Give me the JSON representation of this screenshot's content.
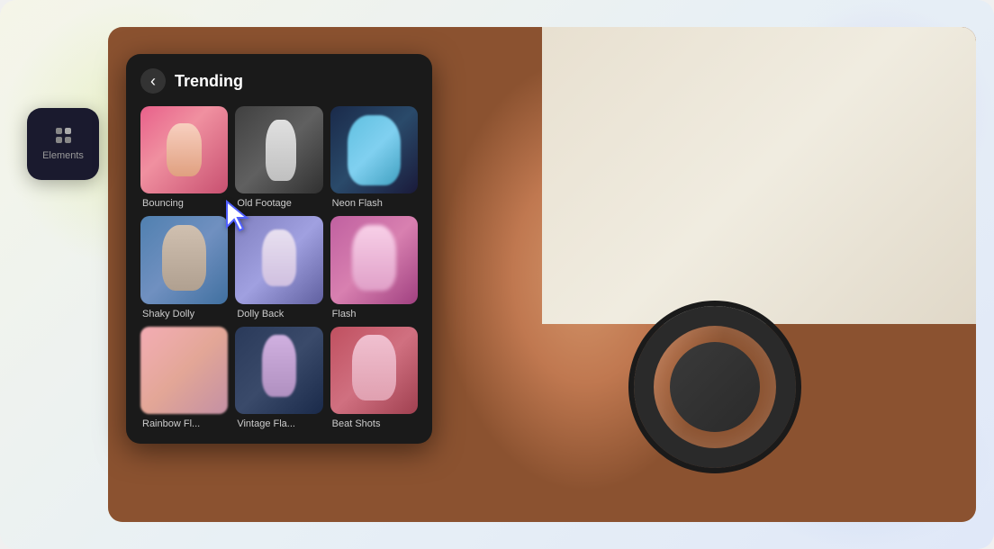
{
  "panel": {
    "title": "Trending",
    "back_button_label": "‹"
  },
  "elements_sidebar": {
    "label": "Elements"
  },
  "effects": [
    {
      "id": "bouncing",
      "label": "Bouncing",
      "thumb_class": "thumb-bouncing"
    },
    {
      "id": "old-footage",
      "label": "Old Footage",
      "thumb_class": "thumb-old-footage"
    },
    {
      "id": "neon-flash",
      "label": "Neon Flash",
      "thumb_class": "thumb-neon-flash"
    },
    {
      "id": "shaky-dolly",
      "label": "Shaky Dolly",
      "thumb_class": "thumb-shaky-dolly"
    },
    {
      "id": "dolly-back",
      "label": "Dolly Back",
      "thumb_class": "thumb-dolly-back"
    },
    {
      "id": "flash",
      "label": "Flash",
      "thumb_class": "thumb-flash"
    },
    {
      "id": "rainbow-fl",
      "label": "Rainbow Fl...",
      "thumb_class": "thumb-rainbow-fl"
    },
    {
      "id": "vintage-fla",
      "label": "Vintage Fla...",
      "thumb_class": "thumb-vintage-fla"
    },
    {
      "id": "beat-shots",
      "label": "Beat Shots",
      "thumb_class": "thumb-beat-shots"
    }
  ],
  "colors": {
    "panel_bg": "#1a1a1a",
    "panel_text": "#ffffff",
    "label_text": "#cccccc",
    "accent": "#6060ff"
  }
}
